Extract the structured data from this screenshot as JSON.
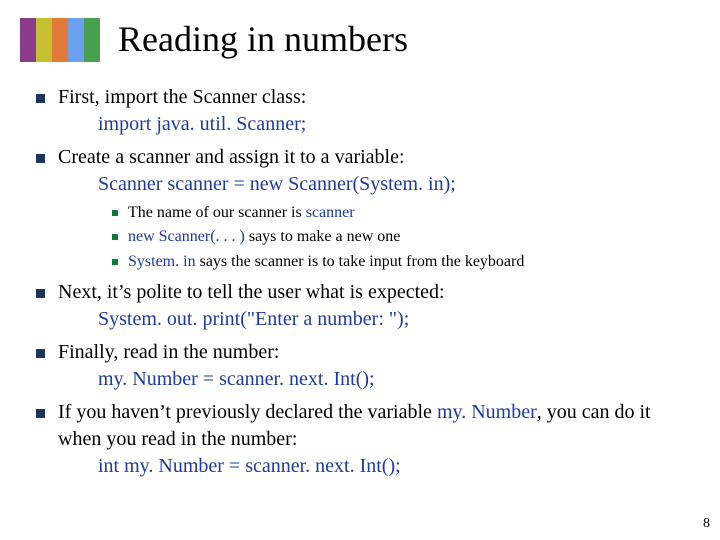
{
  "colors": {
    "bar1": "#8a3c8a",
    "bar2": "#c4c030",
    "bar3": "#e07a3a",
    "bar4": "#6b9ff0",
    "bar5": "#4aa050"
  },
  "title": "Reading in numbers",
  "page_number": "8",
  "b1": {
    "text": "First, import the Scanner class:",
    "code": "import java. util. Scanner;"
  },
  "b2": {
    "text": "Create a scanner and assign it to a variable:",
    "code": "Scanner scanner = new Scanner(System. in);",
    "sub1_a": "The name of our scanner is ",
    "sub1_b": "scanner",
    "sub2_a": "new Scanner(. . . )",
    "sub2_b": " says to make a new one",
    "sub3_a": "System. in",
    "sub3_b": " says the scanner is to take input from the keyboard"
  },
  "b3": {
    "text": "Next, it’s polite to tell the user what is expected:",
    "code": "System. out. print(\"Enter a number:  \");"
  },
  "b4": {
    "text": "Finally, read in the number:",
    "code": "my. Number = scanner. next. Int();"
  },
  "b5": {
    "pre": "If you haven’t previously declared the variable ",
    "var": "my. Number",
    "post": ", you can do it when you read in the number:",
    "code": "int my. Number = scanner. next. Int();"
  }
}
